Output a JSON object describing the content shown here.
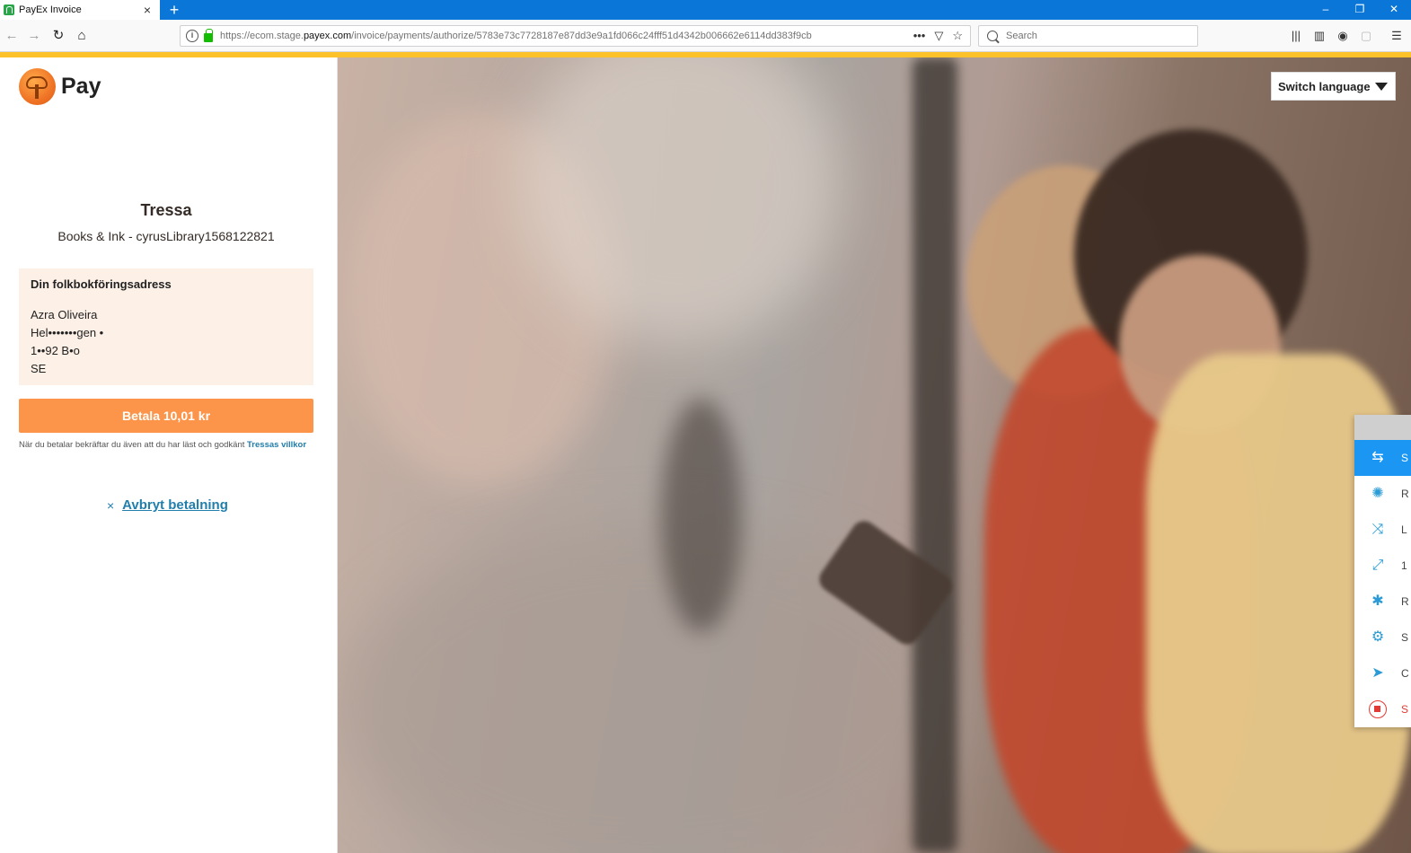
{
  "browser": {
    "tab_title": "PayEx Invoice",
    "tab_close": "×",
    "new_tab": "+",
    "url_prefix": "https://ecom.stage.",
    "url_host": "payex.com",
    "url_path": "/invoice/payments/authorize/5783e73c7728187e87dd3e9a1fd066c24fff51d4342b006662e6114dd383f9cb",
    "search_placeholder": "Search",
    "window_controls": [
      "–",
      "❐",
      "✕"
    ],
    "icons": [
      "back-icon",
      "forward-icon",
      "reload-icon",
      "home-icon",
      "page-actions-icon",
      "pocket-icon",
      "bookmark-star-icon",
      "library-icon",
      "sidebar-icon",
      "account-icon",
      "extension-icon",
      "menu-icon"
    ]
  },
  "colors": {
    "tab_strip": "#0a76d8",
    "accent_line": "#fdc129",
    "pay_button": "#fc9549",
    "address_bg": "#fdf0e7",
    "link": "#227eab",
    "ext_active": "#1b96f3"
  },
  "brand": {
    "logo_text": "Pay"
  },
  "payment": {
    "merchant_name": "Tressa",
    "merchant_sub": "Books & Ink - cyrusLibrary1568122821",
    "address_heading": "Din folkbokföringsadress",
    "address_lines": [
      "Azra Oliveira",
      "Hel•••••••gen •",
      "1••92 B•o",
      "SE"
    ],
    "pay_label": "Betala 10,01 kr",
    "terms_text": "När du betalar bekräftar du även att du har läst och godkänt ",
    "terms_link": "Tressas villkor",
    "cancel_label": "Avbryt betalning",
    "cancel_icon": "×"
  },
  "language": {
    "label": "Switch language"
  },
  "extension_panel": {
    "items": [
      {
        "icon": "swap-arrows-icon",
        "glyph": "⇆",
        "letter": "S",
        "active": true
      },
      {
        "icon": "lightbulb-icon",
        "glyph": "✺",
        "letter": "R",
        "active": false
      },
      {
        "icon": "shuffle-icon",
        "glyph": "⤨",
        "letter": "L",
        "active": false
      },
      {
        "icon": "expand-icon",
        "glyph": "⤢",
        "letter": "1",
        "active": false
      },
      {
        "icon": "bug-icon",
        "glyph": "✱",
        "letter": "R",
        "active": false
      },
      {
        "icon": "gear-icon",
        "glyph": "⚙",
        "letter": "S",
        "active": false
      },
      {
        "icon": "send-icon",
        "glyph": "➤",
        "letter": "C",
        "active": false
      },
      {
        "icon": "stop-icon",
        "glyph": "",
        "letter": "S",
        "active": false
      }
    ]
  }
}
